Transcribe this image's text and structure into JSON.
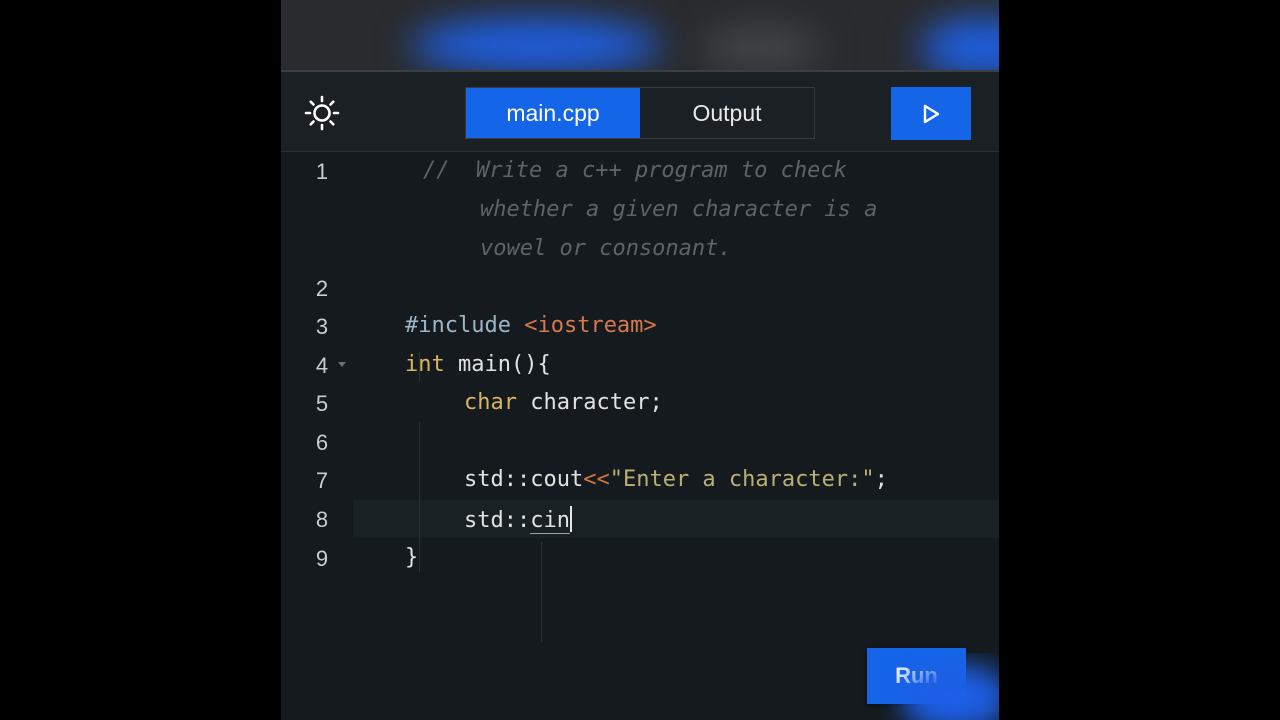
{
  "tabs": [
    {
      "label": "main.cpp",
      "active": true
    },
    {
      "label": "Output",
      "active": false
    }
  ],
  "toolbar": {
    "theme_icon": "sun-icon",
    "play_icon": "play-icon"
  },
  "editor": {
    "line_numbers": [
      "1",
      "2",
      "3",
      "4",
      "5",
      "6",
      "7",
      "8",
      "9"
    ],
    "comment": {
      "prefix": "//",
      "line_a": "Write a c++ program to check",
      "line_b": "whether a given character is a",
      "line_c": "vowel or consonant."
    },
    "line3": {
      "directive": "#include",
      "header": "<iostream>"
    },
    "line4": {
      "keyword": "int",
      "rest": "main(){"
    },
    "line5": {
      "keyword": "char",
      "rest": "character;"
    },
    "line7": {
      "stream": "std::cout",
      "op": "<<",
      "string": "\"Enter a character:\"",
      "end": ";"
    },
    "line8": {
      "scope": "std::",
      "ident": "cin"
    },
    "line9": {
      "brace": "}"
    }
  },
  "run_button": {
    "label": "Run"
  },
  "colors": {
    "accent": "#1565e8",
    "editor_bg": "#141a1d",
    "keyword": "#d7b45f",
    "string": "#b9b174",
    "include_header": "#d9774d"
  }
}
